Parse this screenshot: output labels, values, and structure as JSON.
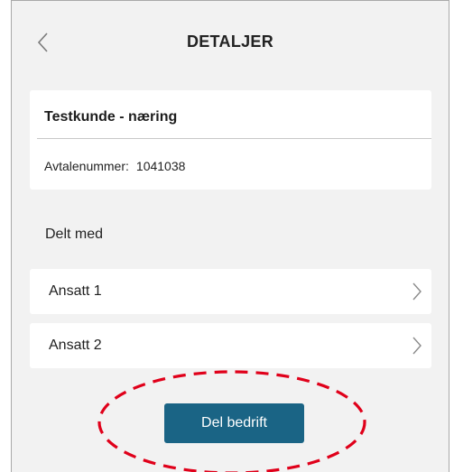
{
  "header": {
    "title": "DETALJER",
    "back_icon": "chevron-left-icon"
  },
  "customer": {
    "name": "Testkunde - næring",
    "agreement_label": "Avtalenummer:",
    "agreement_number": "1041038"
  },
  "shared": {
    "label": "Delt med",
    "items": [
      {
        "label": "Ansatt 1",
        "icon": "chevron-right-icon"
      },
      {
        "label": "Ansatt 2",
        "icon": "chevron-right-icon"
      }
    ]
  },
  "actions": {
    "share_label": "Del bedrift"
  },
  "colors": {
    "accent": "#1a6485",
    "highlight": "#e0001a",
    "background": "#f2f2f2"
  }
}
